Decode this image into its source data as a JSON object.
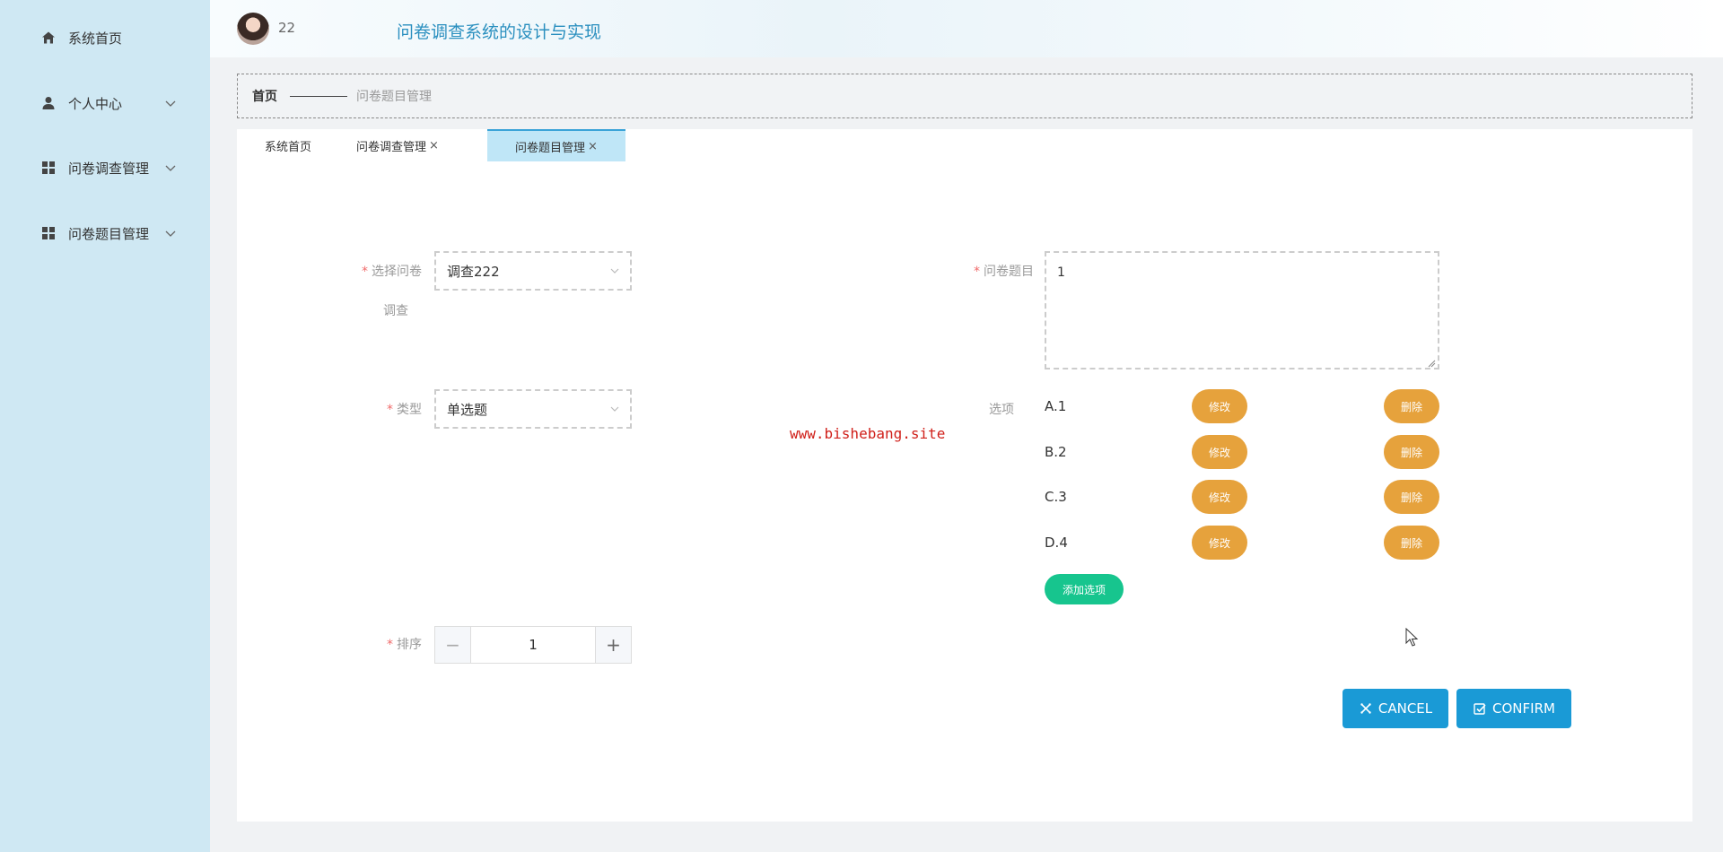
{
  "sidebar": {
    "items": [
      {
        "label": "系统首页",
        "icon": "home-icon"
      },
      {
        "label": "个人中心",
        "icon": "user-icon"
      },
      {
        "label": "问卷调查管理",
        "icon": "grid-icon"
      },
      {
        "label": "问卷题目管理",
        "icon": "grid-icon"
      }
    ]
  },
  "header": {
    "username": "22",
    "app_title": "问卷调查系统的设计与实现"
  },
  "breadcrumb": {
    "home": "首页",
    "current": "问卷题目管理"
  },
  "tabs": [
    {
      "label": "系统首页",
      "closable": false,
      "active": false
    },
    {
      "label": "问卷调查管理",
      "closable": true,
      "active": false
    },
    {
      "label": "问卷题目管理",
      "closable": true,
      "active": true
    }
  ],
  "tab_close_glyph": "×",
  "form": {
    "required_mark": "*",
    "survey_label_line1": "选择问卷",
    "survey_label_line2": "调查",
    "survey_value": "调查222",
    "question_label": "问卷题目",
    "question_value": "1",
    "type_label": "类型",
    "type_value": "单选题",
    "options_label": "选项",
    "options": [
      {
        "text": "A.1"
      },
      {
        "text": "B.2"
      },
      {
        "text": "C.3"
      },
      {
        "text": "D.4"
      }
    ],
    "edit_label": "修改",
    "delete_label": "删除",
    "add_option_label": "添加选项",
    "sort_label": "排序",
    "sort_value": "1"
  },
  "watermark": "www.bishebang.site",
  "actions": {
    "cancel_label": "CANCEL",
    "confirm_label": "CONFIRM"
  },
  "colors": {
    "sidebar_bg": "#cfe8f3",
    "accent": "#1a9ad6",
    "pill_orange": "#e6a23c",
    "add_green": "#17c58e",
    "watermark_red": "#d0201a"
  }
}
